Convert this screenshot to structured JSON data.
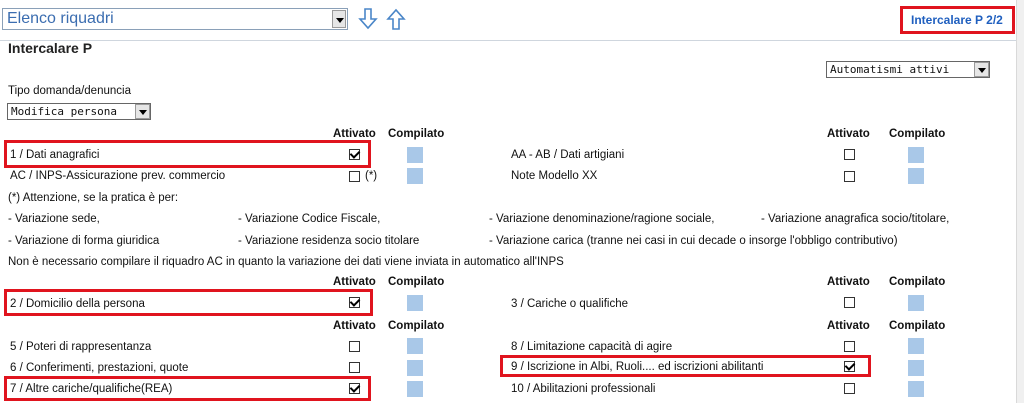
{
  "top": {
    "select_value": "Elenco riquadri",
    "link": "Intercalare P 2/2"
  },
  "page": {
    "title": "Intercalare P",
    "automatismi": "Automatismi attivi",
    "tipo_label": "Tipo domanda/denuncia",
    "tipo_value": "Modifica persona"
  },
  "headers": {
    "attivato": "Attivato",
    "compilato": "Compilato"
  },
  "rows": [
    {
      "label": "1 / Dati anagrafici",
      "checked": true
    },
    {
      "label": "AA - AB / Dati artigiani",
      "checked": false
    },
    {
      "label": "AC / INPS-Assicurazione prev. commercio",
      "checked": false,
      "note": "(*)"
    },
    {
      "label": "Note Modello XX",
      "checked": false
    },
    {
      "label": "2 / Domicilio della persona",
      "checked": true
    },
    {
      "label": "3 / Cariche o qualifiche",
      "checked": false
    },
    {
      "label": "5 / Poteri di rappresentanza",
      "checked": false
    },
    {
      "label": "8 / Limitazione capacità di agire",
      "checked": false
    },
    {
      "label": "6 / Conferimenti, prestazioni, quote",
      "checked": false
    },
    {
      "label": "9 / Iscrizione in Albi, Ruoli.... ed iscrizioni abilitanti",
      "checked": true
    },
    {
      "label": "7 / Altre cariche/qualifiche(REA)",
      "checked": true
    },
    {
      "label": "10 / Abilitazioni professionali",
      "checked": false
    }
  ],
  "notes": {
    "attenzione": "(*) Attenzione, se la pratica è per:",
    "v1": "- Variazione sede,",
    "v2": "- Variazione Codice Fiscale,",
    "v3": "- Variazione denominazione/ragione sociale,",
    "v4": "- Variazione anagrafica socio/titolare,",
    "v5": "- Variazione di forma giuridica",
    "v6": "- Variazione residenza socio titolare",
    "v7": "- Variazione carica (tranne nei casi in cui decade o insorge l'obbligo contributivo)",
    "footer": "Non è necessario compilare il riquadro AC in quanto la variazione dei dati viene inviata in automatico all'INPS"
  },
  "colors": {
    "highlight": "#e0141e",
    "link": "#1f5fbf",
    "compiled": "#a9c8e8"
  }
}
